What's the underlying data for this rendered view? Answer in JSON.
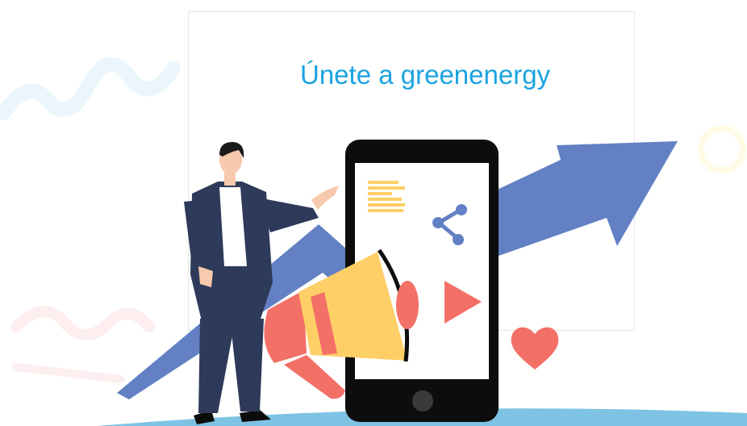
{
  "page": {
    "title": "Únete a greenenergy"
  },
  "colors": {
    "title": "#1aa3e0",
    "arrow": "#6280c3",
    "phone_body": "#0d0d0d",
    "phone_screen": "#ffffff",
    "megaphone_yellow": "#ffcf67",
    "megaphone_red": "#f37067",
    "accent_red": "#f37067",
    "share": "#6280c3",
    "suit": "#2e3a59",
    "ground": "#7ec3e4"
  },
  "icons": {
    "share": "share-icon",
    "play": "play-icon",
    "heart": "heart-icon",
    "megaphone": "megaphone-icon",
    "text_lines": "text-lines-icon"
  }
}
